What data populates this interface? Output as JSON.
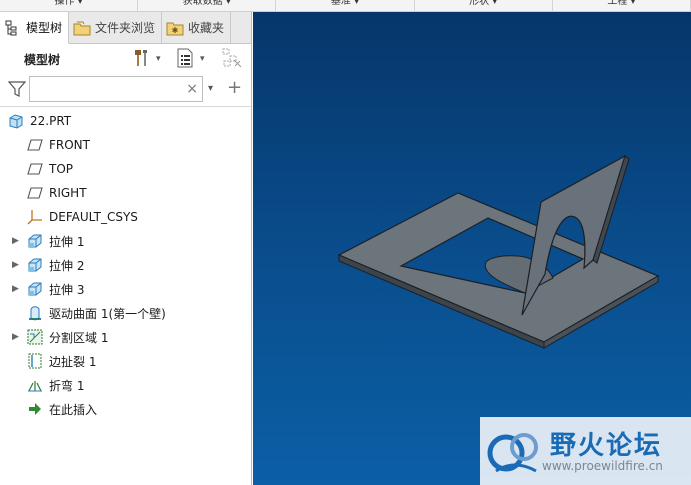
{
  "ribbon": {
    "groups": [
      "操作 ▾",
      "获取数据 ▾",
      "基准 ▾",
      "形状 ▾",
      "工程 ▾"
    ]
  },
  "panel_tabs": [
    {
      "label": "模型树",
      "icon": "model-tree-icon"
    },
    {
      "label": "文件夹浏览",
      "icon": "folder-icon"
    },
    {
      "label": "收藏夹",
      "icon": "favorites-icon"
    }
  ],
  "tree_header": {
    "title": "模型树",
    "settings_icon": "tools-icon",
    "show_icon": "list-icon",
    "filter_icon": "tree-filter-icon"
  },
  "filter": {
    "value": "",
    "placeholder": "",
    "clear_symbol": "×",
    "add_symbol": "+"
  },
  "tree": [
    {
      "label": "22.PRT",
      "icon": "part-icon",
      "expandable": false
    },
    {
      "label": "FRONT",
      "icon": "datum-plane-icon",
      "expandable": false
    },
    {
      "label": "TOP",
      "icon": "datum-plane-icon",
      "expandable": false
    },
    {
      "label": "RIGHT",
      "icon": "datum-plane-icon",
      "expandable": false
    },
    {
      "label": "DEFAULT_CSYS",
      "icon": "csys-icon",
      "expandable": false
    },
    {
      "label": "拉伸 1",
      "icon": "extrude-icon",
      "expandable": true
    },
    {
      "label": "拉伸 2",
      "icon": "extrude-icon",
      "expandable": true
    },
    {
      "label": "拉伸 3",
      "icon": "extrude-icon",
      "expandable": true
    },
    {
      "label": "驱动曲面 1(第一个壁)",
      "icon": "driving-surface-icon",
      "expandable": false
    },
    {
      "label": "分割区域 1",
      "icon": "split-area-icon",
      "expandable": true
    },
    {
      "label": "边扯裂 1",
      "icon": "edge-rip-icon",
      "expandable": false
    },
    {
      "label": "折弯 1",
      "icon": "bend-icon",
      "expandable": false
    },
    {
      "label": "在此插入",
      "icon": "insert-here-icon",
      "expandable": false
    }
  ],
  "watermark": {
    "title": "野火论坛",
    "url": "www.proewildfire.cn"
  },
  "colors": {
    "viewport_top": "#06366a",
    "viewport_bottom": "#0b5fa6",
    "model_face": "#6f7780",
    "model_edge": "#1b1f24",
    "accent": "#1a6bb5"
  }
}
